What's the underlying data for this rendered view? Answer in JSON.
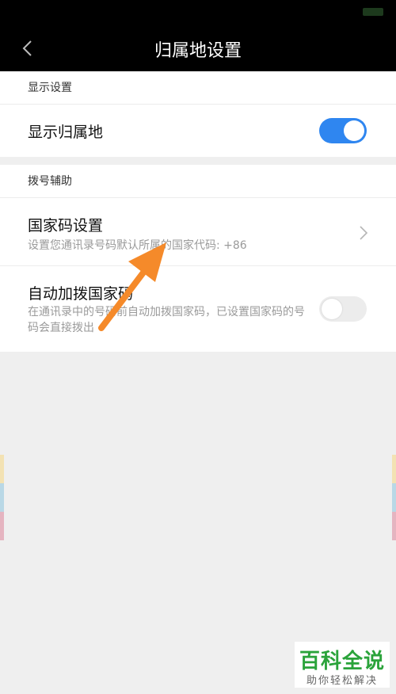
{
  "header": {
    "title": "归属地设置",
    "back_icon": "chevron-left-icon"
  },
  "display_section": {
    "header": "显示设置",
    "show_location": {
      "label": "显示归属地",
      "enabled": true
    }
  },
  "dial_section": {
    "header": "拨号辅助",
    "country_code": {
      "label": "国家码设置",
      "description": "设置您通讯录号码默认所属的国家代码: +86",
      "icon": "chevron-right-icon"
    },
    "auto_dial": {
      "label": "自动加拨国家码",
      "description": "在通讯录中的号码前自动加拨国家码，已设置国家码的号码会直接拨出",
      "enabled": false
    }
  },
  "watermark": {
    "main": "百科全说",
    "sub": "助你轻松解决"
  },
  "colors": {
    "toggle_on": "#2f86f0",
    "arrow": "#f58a2a",
    "brand_green": "#2aa33a"
  }
}
